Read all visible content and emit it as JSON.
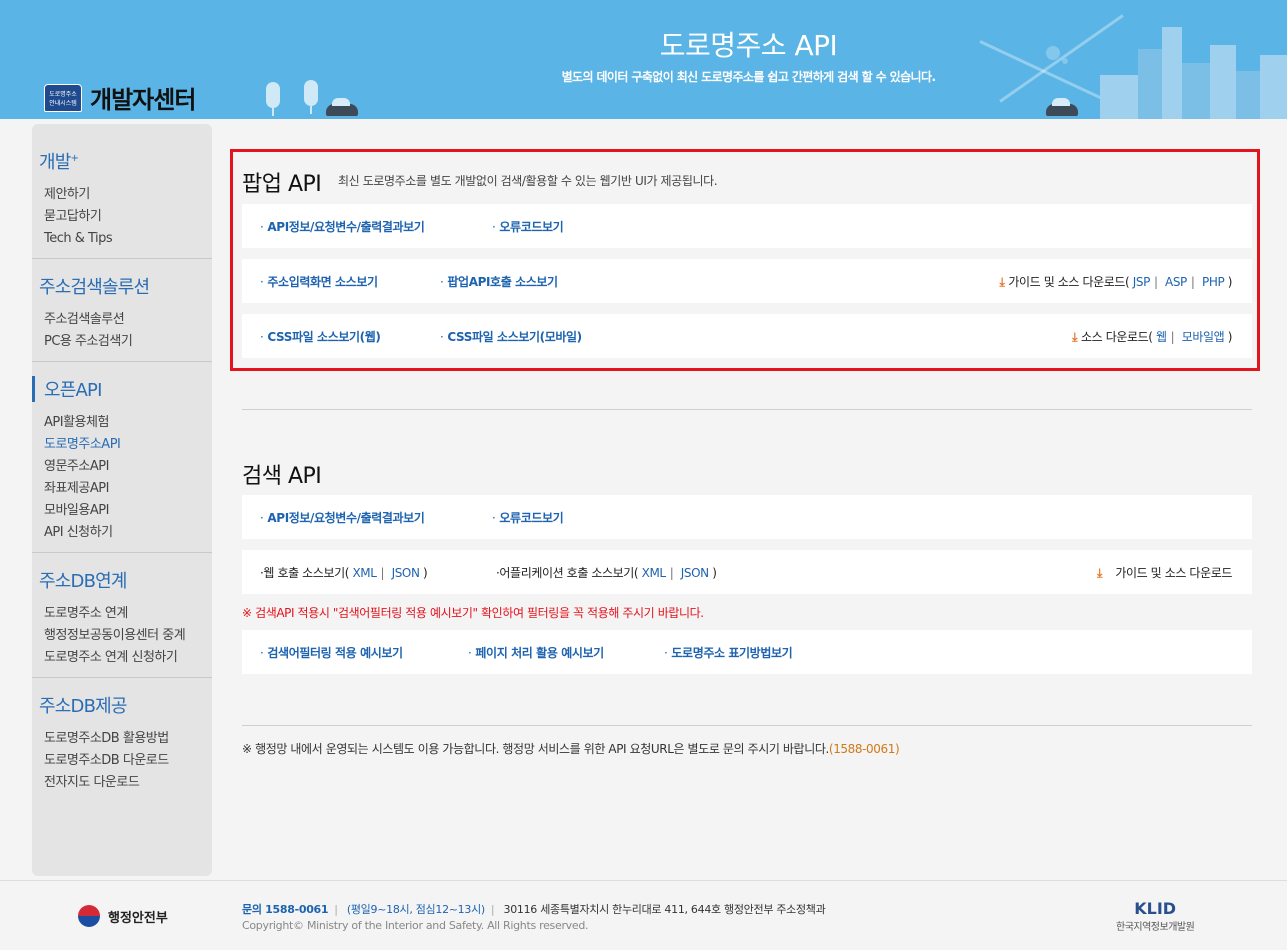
{
  "header": {
    "logo_badge_line1": "도로명주소",
    "logo_badge_line2": "안내시스템",
    "logo_text": "개발자센터",
    "title": "도로명주소 API",
    "subtitle": "별도의 데이터 구축없이 최신 도로명주소를 쉽고 간편하게 검색 할 수 있습니다."
  },
  "sidebar": {
    "groups": [
      {
        "title": "개발",
        "title_sup": "+",
        "items": [
          "제안하기",
          "묻고답하기",
          "Tech & Tips"
        ]
      },
      {
        "title": "주소검색솔루션",
        "items": [
          "주소검색솔루션",
          "PC용 주소검색기"
        ]
      },
      {
        "title": "오픈API",
        "items": [
          "API활용체험",
          "도로명주소API",
          "영문주소API",
          "좌표제공API",
          "모바일용API",
          "API 신청하기"
        ]
      },
      {
        "title": "주소DB연계",
        "items": [
          "도로명주소 연계",
          "행정정보공동이용센터 중계",
          "도로명주소 연계 신청하기"
        ]
      },
      {
        "title": "주소DB제공",
        "items": [
          "도로명주소DB 활용방법",
          "도로명주소DB 다운로드",
          "전자지도 다운로드"
        ]
      }
    ]
  },
  "popup": {
    "title": "팝업 API",
    "desc": "최신 도로명주소를 별도 개발없이 검색/활용할 수 있는 웹기반 UI가 제공됩니다.",
    "row1": {
      "api_info": "API정보/요청변수/출력결과보기",
      "error_code": "오류코드보기"
    },
    "row2": {
      "addr_input_src": "주소입력화면 소스보기",
      "popup_call_src": "팝업API호출 소스보기",
      "download_label": "가이드 및 소스 다운로드(",
      "jsp": "JSP",
      "asp": "ASP",
      "php": "PHP",
      "close": ")"
    },
    "row3": {
      "css_web": "CSS파일 소스보기(웹)",
      "css_mobile": "CSS파일 소스보기(모바일)",
      "download_label": "소스 다운로드(",
      "web": "웹",
      "mobile_app": "모바일앱",
      "close": ")"
    }
  },
  "search": {
    "title": "검색 API",
    "row1": {
      "api_info": "API정보/요청변수/출력결과보기",
      "error_code": "오류코드보기"
    },
    "row2": {
      "web_call": "웹 호출 소스보기(",
      "app_call": "어플리케이션 호출 소스보기(",
      "xml": "XML",
      "json": "JSON",
      "close": ")",
      "download": "가이드 및 소스 다운로드"
    },
    "warning": "※ 검색API 적용시 \"검색어필터링 적용 예시보기\" 확인하여 필터링을 꼭 적용해 주시기 바랍니다.",
    "row3": {
      "filter_example": "검색어필터링 적용 예시보기",
      "paging_example": "페이지 처리 활용 예시보기",
      "notation": "도로명주소 표기방법보기"
    }
  },
  "note": {
    "text": "※ 행정망 내에서 운영되는 시스템도 이용 가능합니다. 행정망 서비스를 위한 API 요청URL은 별도로 문의 주시기 바랍니다.",
    "phone": "(1588-0061)"
  },
  "footer": {
    "ministry": "행정안전부",
    "contact": "문의 1588-0061",
    "hours": "(평일9~18시, 점심12~13시)",
    "address": "30116 세종특별자치시 한누리대로 411, 644호 행정안전부 주소정책과",
    "copyright": "Copyright© Ministry of the Interior and Safety. All Rights reserved.",
    "klid_logo": "KLID",
    "klid_name": "한국지역정보개발원"
  },
  "colors": {
    "header_bg": "#5ab4e5",
    "link": "#1e63b0",
    "highlight_border": "#e3141d",
    "download_icon": "#e8742a"
  }
}
